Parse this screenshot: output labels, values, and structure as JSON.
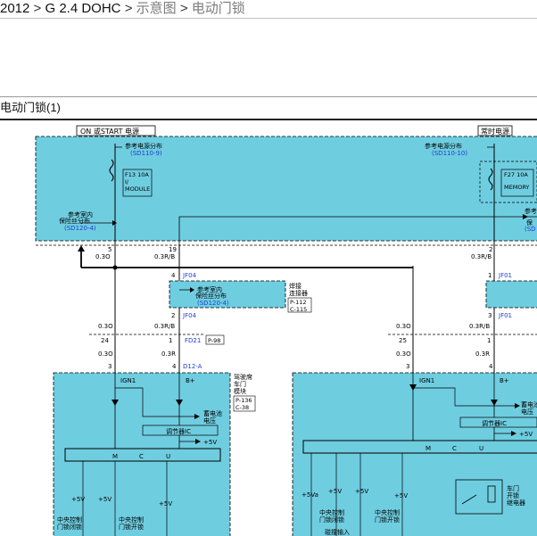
{
  "breadcrumb": {
    "year": "2012",
    "engine": "G 2.4 DOHC",
    "schematic": "示意图",
    "current": "电动门锁",
    "separator": ">"
  },
  "section_title": "电动门锁(1)",
  "diagram": {
    "power_on_start": "ON 或START 电源",
    "power_constant": "常时电源",
    "ref_power_left": "参考电源分布",
    "ref_power_left_code": "(SD110-9)",
    "ref_power_right": "参考电源分布",
    "ref_power_right_code": "(SD110-10)",
    "fuse_left": [
      "F13 10A",
      "I/",
      "MODULE"
    ],
    "fuse_right": [
      "F27 10A",
      "MEMORY"
    ],
    "ref_interior_left": [
      "参考室内",
      "保险丝分布"
    ],
    "ref_interior_left_code": "(SD120-4)",
    "ref_interior_right": [
      "参考",
      "保"
    ],
    "ref_interior_right_code": "(SD",
    "wires": {
      "w_5": "5",
      "w_5_spec": "0.3O",
      "w_19": "19",
      "w_19_spec": "0.3R/B",
      "w_2r": "2",
      "w_2r_spec": "0.3R/B",
      "w_jf04_4": "4",
      "w_jf04_2": "2",
      "w_jf01_1": "1",
      "w_jf01_3": "3",
      "w_03o_a": "0.3O",
      "w_03rb_a": "0.3R/B",
      "w_03o_b": "0.3O",
      "w_03rb_b": "0.3R/B",
      "w_24": "24",
      "w_1a": "1",
      "w_25": "25",
      "w_1b": "1",
      "w_03o_c": "0.3O",
      "w_03r_c": "0.3R",
      "w_03o_d": "0.3O",
      "w_03r_d": "0.3R",
      "w_3a": "3",
      "w_4a": "4",
      "w_3b": "3",
      "w_4b": "4"
    },
    "jf04": "JF04",
    "jf01": "JF01",
    "ref_interior_mid": [
      "参考室内",
      "保险丝分布"
    ],
    "ref_interior_mid_code": "(SD120-4)",
    "splice": [
      "焊接",
      "连接器"
    ],
    "splice_codes": [
      "P-112",
      "C-115"
    ],
    "fd21": "FD21",
    "fd21_code": "P-98",
    "d12a": "D12-A",
    "module_left_label": [
      "驾驶席",
      "车门",
      "模块"
    ],
    "module_left_codes": [
      "P-136",
      "C-38"
    ],
    "ign1": "IGN1",
    "bplus": "B+",
    "battery_voltage": [
      "蓄电池",
      "电压"
    ],
    "regulator_ic": "调节器IC",
    "plus5v": "+5V",
    "plus5va": "+5Va",
    "mcu": [
      "M",
      "C",
      "U"
    ],
    "central_lock": [
      "中央控制",
      "门锁闭锁"
    ],
    "central_unlock": [
      "中央控制",
      "门锁开锁"
    ],
    "door_unlock_relay": [
      "车门",
      "开锁",
      "继电器"
    ],
    "key_input": "碰撞输入"
  }
}
